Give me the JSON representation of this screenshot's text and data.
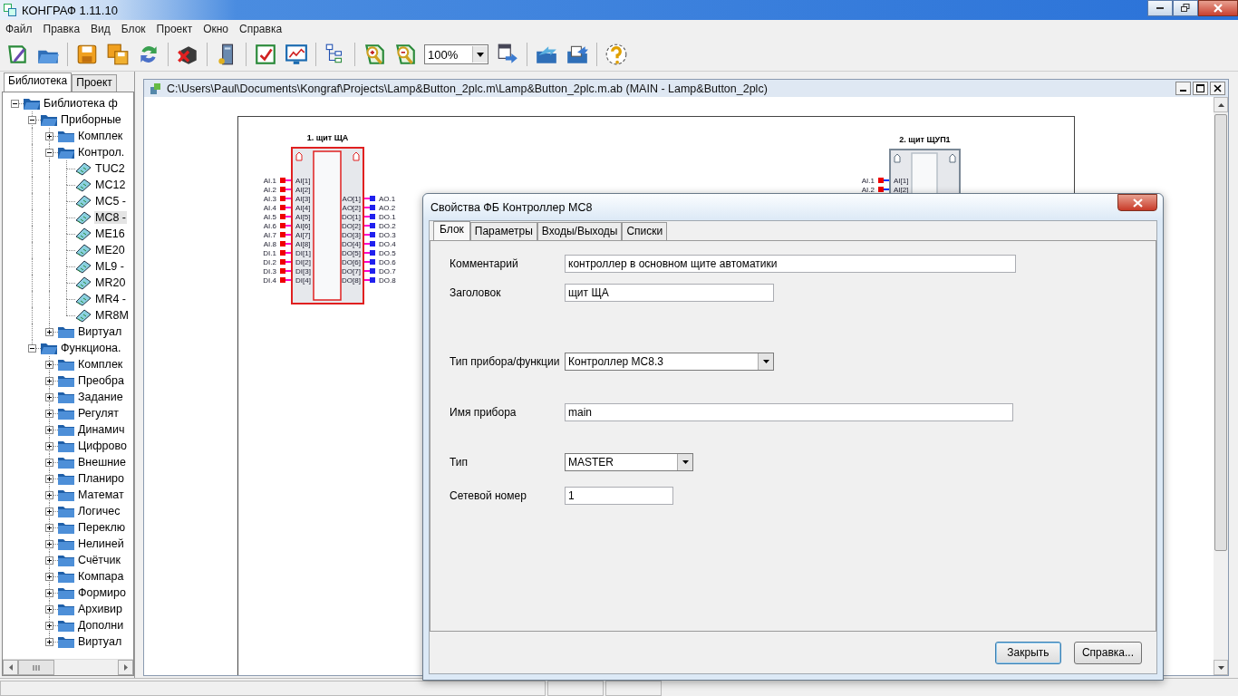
{
  "window": {
    "title": "КОНГРАФ 1.11.10"
  },
  "menu": [
    "Файл",
    "Правка",
    "Вид",
    "Блок",
    "Проект",
    "Окно",
    "Справка"
  ],
  "toolbar": {
    "zoom": "100%"
  },
  "side_tabs": [
    {
      "label": "Библиотека",
      "selected": true
    },
    {
      "label": "Проект",
      "selected": false
    }
  ],
  "tree": [
    {
      "label": "Библиотека ф",
      "kind": "folder",
      "expanded": true,
      "selected": false,
      "children": [
        {
          "label": "Приборные",
          "kind": "folder",
          "expanded": true,
          "selected": false,
          "children": [
            {
              "label": "Комплек",
              "kind": "folder",
              "expanded": false,
              "selected": false
            },
            {
              "label": "Контрол.",
              "kind": "folder",
              "expanded": true,
              "selected": false,
              "children": [
                {
                  "label": "TUC2",
                  "kind": "device",
                  "selected": false
                },
                {
                  "label": "MC12",
                  "kind": "device",
                  "selected": false
                },
                {
                  "label": "MC5 -",
                  "kind": "device",
                  "selected": false
                },
                {
                  "label": "MC8 -",
                  "kind": "device",
                  "selected": true
                },
                {
                  "label": "ME16",
                  "kind": "device",
                  "selected": false
                },
                {
                  "label": "ME20",
                  "kind": "device",
                  "selected": false
                },
                {
                  "label": "ML9 -",
                  "kind": "device",
                  "selected": false
                },
                {
                  "label": "MR20",
                  "kind": "device",
                  "selected": false
                },
                {
                  "label": "MR4 -",
                  "kind": "device",
                  "selected": false
                },
                {
                  "label": "MR8M",
                  "kind": "device",
                  "selected": false
                }
              ]
            },
            {
              "label": "Виртуал",
              "kind": "folder",
              "expanded": false,
              "selected": false
            }
          ]
        },
        {
          "label": "Функциона.",
          "kind": "folder",
          "expanded": true,
          "selected": false,
          "children": [
            {
              "label": "Комплек",
              "kind": "folder",
              "expanded": false,
              "selected": false
            },
            {
              "label": "Преобра",
              "kind": "folder",
              "expanded": false,
              "selected": false
            },
            {
              "label": "Задание",
              "kind": "folder",
              "expanded": false,
              "selected": false
            },
            {
              "label": "Регулят",
              "kind": "folder",
              "expanded": false,
              "selected": false
            },
            {
              "label": "Динамич",
              "kind": "folder",
              "expanded": false,
              "selected": false
            },
            {
              "label": "Цифрово",
              "kind": "folder",
              "expanded": false,
              "selected": false
            },
            {
              "label": "Внешние",
              "kind": "folder",
              "expanded": false,
              "selected": false
            },
            {
              "label": "Планиро",
              "kind": "folder",
              "expanded": false,
              "selected": false
            },
            {
              "label": "Математ",
              "kind": "folder",
              "expanded": false,
              "selected": false
            },
            {
              "label": "Логичес",
              "kind": "folder",
              "expanded": false,
              "selected": false
            },
            {
              "label": "Переклю",
              "kind": "folder",
              "expanded": false,
              "selected": false
            },
            {
              "label": "Нелиней",
              "kind": "folder",
              "expanded": false,
              "selected": false
            },
            {
              "label": "Счётчик",
              "kind": "folder",
              "expanded": false,
              "selected": false
            },
            {
              "label": "Компара",
              "kind": "folder",
              "expanded": false,
              "selected": false
            },
            {
              "label": "Формиро",
              "kind": "folder",
              "expanded": false,
              "selected": false
            },
            {
              "label": "Архивир",
              "kind": "folder",
              "expanded": false,
              "selected": false
            },
            {
              "label": "Дополни",
              "kind": "folder",
              "expanded": false,
              "selected": false
            },
            {
              "label": "Виртуал",
              "kind": "folder",
              "expanded": false,
              "selected": false
            }
          ]
        }
      ]
    }
  ],
  "document": {
    "title": "C:\\Users\\Paul\\Documents\\Kongraf\\Projects\\Lamp&Button_2plc.m\\Lamp&Button_2plc.m.ab (MAIN - Lamp&Button_2plc)",
    "blocks": [
      {
        "title": "1. щит ЩА",
        "selected": true,
        "color": "#ff00cc",
        "inputs": [
          {
            "outer": "AI.1",
            "inner": "AI[1]"
          },
          {
            "outer": "AI.2",
            "inner": "AI[2]"
          },
          {
            "outer": "AI.3",
            "inner": "AI[3]"
          },
          {
            "outer": "AI.4",
            "inner": "AI[4]"
          },
          {
            "outer": "AI.5",
            "inner": "AI[5]"
          },
          {
            "outer": "AI.6",
            "inner": "AI[6]"
          },
          {
            "outer": "AI.7",
            "inner": "AI[7]"
          },
          {
            "outer": "AI.8",
            "inner": "AI[8]"
          },
          {
            "outer": "DI.1",
            "inner": "DI[1]"
          },
          {
            "outer": "DI.2",
            "inner": "DI[2]"
          },
          {
            "outer": "DI.3",
            "inner": "DI[3]"
          },
          {
            "outer": "DI.4",
            "inner": "DI[4]"
          }
        ],
        "outputs": [
          {
            "outer": "AO.1",
            "inner": "AO[1]"
          },
          {
            "outer": "AO.2",
            "inner": "AO[2]"
          },
          {
            "outer": "DO.1",
            "inner": "DO[1]"
          },
          {
            "outer": "DO.2",
            "inner": "DO[2]"
          },
          {
            "outer": "DO.3",
            "inner": "DO[3]"
          },
          {
            "outer": "DO.4",
            "inner": "DO[4]"
          },
          {
            "outer": "DO.5",
            "inner": "DO[5]"
          },
          {
            "outer": "DO.6",
            "inner": "DO[6]"
          },
          {
            "outer": "DO.7",
            "inner": "DO[7]"
          },
          {
            "outer": "DO.8",
            "inner": "DO[8]"
          }
        ]
      },
      {
        "title": "2. щит ЩУП1",
        "selected": false,
        "color": "#0033ff",
        "inputs": [
          {
            "outer": "AI.1",
            "inner": "AI[1]"
          },
          {
            "outer": "AI.2",
            "inner": "AI[2]"
          }
        ]
      }
    ]
  },
  "dialog": {
    "title": "Свойства ФБ Контроллер МС8",
    "tabs": [
      {
        "label": "Блок",
        "selected": true
      },
      {
        "label": "Параметры",
        "selected": false
      },
      {
        "label": "Входы/Выходы",
        "selected": false
      },
      {
        "label": "Списки",
        "selected": false
      }
    ],
    "fields": [
      {
        "label": "Комментарий",
        "kind": "text",
        "value": "контроллер в основном щите автоматики"
      },
      {
        "label": "Заголовок",
        "kind": "text",
        "value": "щит ЩА"
      },
      {
        "label": "Тип прибора/функции",
        "kind": "select",
        "value": "Контроллер МС8.3"
      },
      {
        "label": "Имя прибора",
        "kind": "text",
        "value": "main"
      },
      {
        "label": "Тип",
        "kind": "select",
        "value": "MASTER"
      },
      {
        "label": "Сетевой номер",
        "kind": "text",
        "value": "1"
      }
    ],
    "buttons": [
      {
        "label": "Закрыть",
        "focused": true
      },
      {
        "label": "Справка...",
        "focused": false
      }
    ]
  }
}
